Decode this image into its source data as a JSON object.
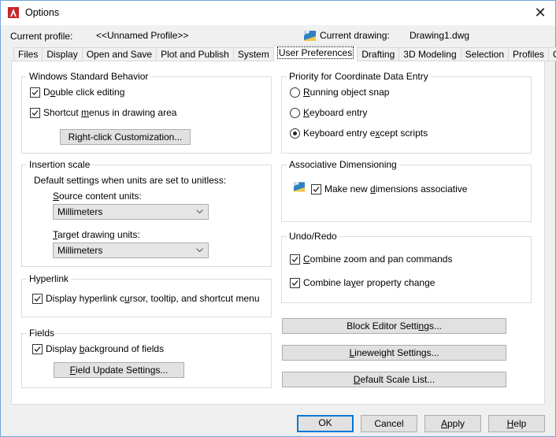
{
  "window": {
    "title": "Options",
    "app_icon": "autocad-logo-icon",
    "close_icon": "close-icon",
    "close_glyph": "✕"
  },
  "header": {
    "current_profile_label": "Current profile:",
    "current_profile_value": "<<Unnamed Profile>>",
    "current_drawing_icon": "drawing-file-icon",
    "current_drawing_label": "Current drawing:",
    "current_drawing_value": "Drawing1.dwg"
  },
  "tabs": [
    {
      "label": "Files",
      "active": false
    },
    {
      "label": "Display",
      "active": false
    },
    {
      "label": "Open and Save",
      "active": false
    },
    {
      "label": "Plot and Publish",
      "active": false
    },
    {
      "label": "System",
      "active": false
    },
    {
      "label": "User Preferences",
      "active": true
    },
    {
      "label": "Drafting",
      "active": false
    },
    {
      "label": "3D Modeling",
      "active": false
    },
    {
      "label": "Selection",
      "active": false
    },
    {
      "label": "Profiles",
      "active": false
    },
    {
      "label": "Online",
      "active": false
    }
  ],
  "windows_standard_behavior": {
    "title": "Windows Standard Behavior",
    "double_click_editing": {
      "pre": "D",
      "u": "o",
      "post": "uble click editing",
      "checked": true
    },
    "shortcut_menus": {
      "pre": "Shortcut ",
      "u": "m",
      "post": "enus in drawing area",
      "checked": true
    },
    "right_click_button": {
      "pre": "Ri",
      "u": "g",
      "post": "ht-click Customization..."
    }
  },
  "insertion_scale": {
    "title": "Insertion scale",
    "description": "Default settings when units are set to unitless:",
    "source_label": {
      "pre": "",
      "u": "S",
      "post": "ource content units:"
    },
    "source_value": "Millimeters",
    "target_label": {
      "pre": "",
      "u": "T",
      "post": "arget drawing units:"
    },
    "target_value": "Millimeters"
  },
  "hyperlink": {
    "title": "Hyperlink",
    "display_hyperlink": {
      "pre": "Display hyperlink c",
      "u": "u",
      "post": "rsor, tooltip, and shortcut menu",
      "checked": true
    }
  },
  "fields": {
    "title": "Fields",
    "display_background": {
      "pre": "Display ",
      "u": "b",
      "post": "ackground of fields",
      "checked": true
    },
    "field_update_button": {
      "pre": "",
      "u": "F",
      "post": "ield Update Settings..."
    }
  },
  "coordinate_priority": {
    "title": "Priority for Coordinate Data Entry",
    "options": [
      {
        "pre": "",
        "u": "R",
        "post": "unning object snap",
        "selected": false
      },
      {
        "pre": "",
        "u": "K",
        "post": "eyboard entry",
        "selected": false
      },
      {
        "pre": "Keyboard entry e",
        "u": "x",
        "post": "cept scripts",
        "selected": true
      }
    ]
  },
  "associative_dimensioning": {
    "title": "Associative Dimensioning",
    "icon": "drawing-file-icon",
    "make_associative": {
      "pre": "Make new ",
      "u": "d",
      "post": "imensions associative",
      "checked": true
    }
  },
  "undo_redo": {
    "title": "Undo/Redo",
    "combine_zoom_pan": {
      "pre": "",
      "u": "C",
      "post": "ombine zoom and pan commands",
      "checked": true
    },
    "combine_layer": {
      "pre": "Combine la",
      "u": "y",
      "post": "er property change",
      "checked": true
    }
  },
  "settings_buttons": {
    "block_editor": {
      "pre": "Block Editor Setti",
      "u": "n",
      "post": "gs..."
    },
    "lineweight": {
      "pre": "",
      "u": "L",
      "post": "ineweight Settings..."
    },
    "default_scale_list": {
      "pre": "",
      "u": "D",
      "post": "efault Scale List..."
    }
  },
  "footer": {
    "ok": {
      "pre": "OK",
      "u": "",
      "post": ""
    },
    "cancel": {
      "pre": "Cancel",
      "u": "",
      "post": ""
    },
    "apply": {
      "pre": "",
      "u": "A",
      "post": "pply"
    },
    "help": {
      "pre": "",
      "u": "H",
      "post": "elp"
    }
  }
}
